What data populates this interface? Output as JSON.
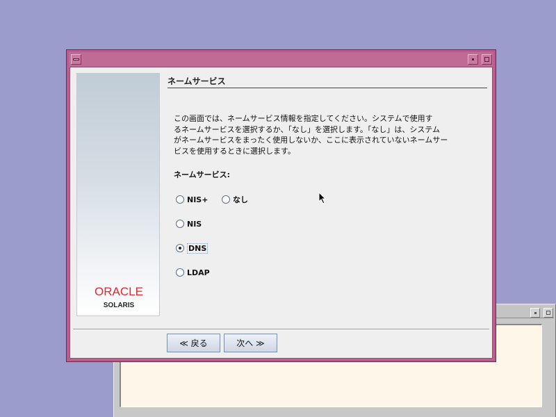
{
  "dialog": {
    "section_title": "ネームサービス",
    "description_lines": [
      "この画面では、ネームサービス情報を指定してください。システムで使用す",
      "るネームサービスを選択するか、「なし」を選択します。「なし」は、システム",
      "がネームサービスをまったく使用しないか、ここに表示されていないネームサー",
      "ビスを使用するときに選択します。"
    ],
    "field_label": "ネームサービス:",
    "options": {
      "nis_plus": "NIS+",
      "none": "なし",
      "nis": "NIS",
      "dns": "DNS",
      "ldap": "LDAP"
    },
    "selected_option": "DNS",
    "back_label": "≪ 戻る",
    "next_label": "次へ ≫"
  },
  "branding": {
    "oracle": "ORACLE",
    "solaris": "SOLARIS"
  },
  "colors": {
    "desktop": "#9b9bcc",
    "window_frame": "#bf6b96",
    "oracle_red": "#e8262c"
  }
}
